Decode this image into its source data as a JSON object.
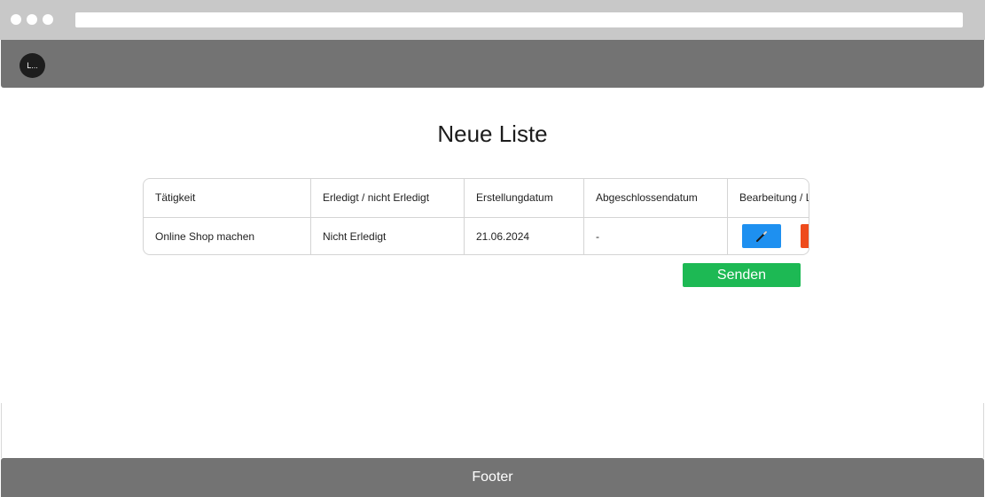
{
  "header": {
    "logo_text": "L..."
  },
  "main": {
    "title": "Neue Liste",
    "table": {
      "columns": [
        "Tätigkeit",
        "Erledigt / nicht Erledigt",
        "Erstellungdatum",
        "Abgeschlossendatum",
        "Bearbeitung / Löschen"
      ],
      "rows": [
        {
          "task": "Online Shop machen",
          "status": "Nicht Erledigt",
          "created": "21.06.2024",
          "completed": "-",
          "edit_icon": "pencil-icon",
          "delete_icon": "trash-icon"
        }
      ]
    },
    "send_label": "Senden"
  },
  "footer": {
    "text": "Footer"
  },
  "colors": {
    "header_bg": "#737373",
    "edit_button": "#1e90f0",
    "delete_button": "#ee4b1c",
    "send_button": "#1db954"
  }
}
